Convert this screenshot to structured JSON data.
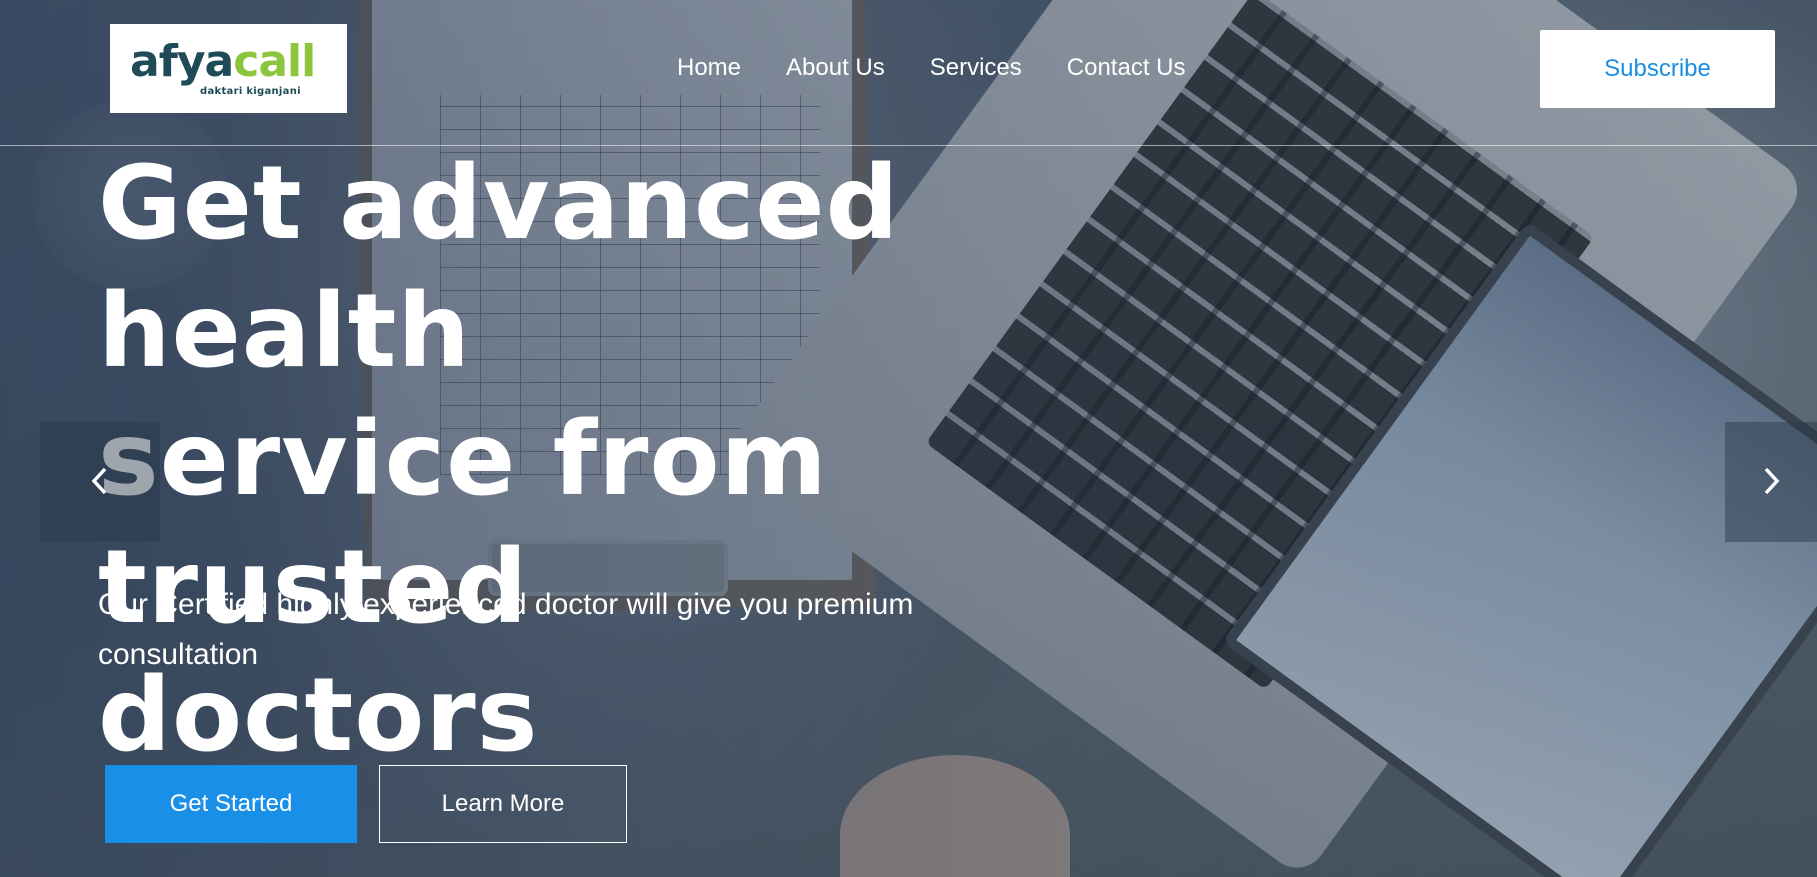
{
  "brand": {
    "logo_main_dark": "af",
    "logo_main_mid": "y",
    "logo_main_dark2": "a",
    "logo_main_green": "call",
    "logo_tagline": "daktari kiganjani",
    "colors": {
      "dark": "#1e4b57",
      "green": "#8cc63f"
    }
  },
  "nav": {
    "items": [
      {
        "label": "Home"
      },
      {
        "label": "About Us"
      },
      {
        "label": "Services"
      },
      {
        "label": "Contact Us"
      }
    ],
    "subscribe_label": "Subscribe"
  },
  "hero": {
    "headline_line1": "Get advanced health",
    "headline_line2": "service from trusted",
    "headline_line3": "doctors",
    "subtext_line1": "Our Certified highly experienced doctor will give you premium",
    "subtext_line2": "consultation",
    "primary_button": "Get Started",
    "secondary_button": "Learn More"
  },
  "carousel": {
    "prev_icon": "chevron-left-icon",
    "next_icon": "chevron-right-icon"
  },
  "colors": {
    "accent": "#1a8fe8",
    "subscribe_text": "#1a8fe0"
  }
}
